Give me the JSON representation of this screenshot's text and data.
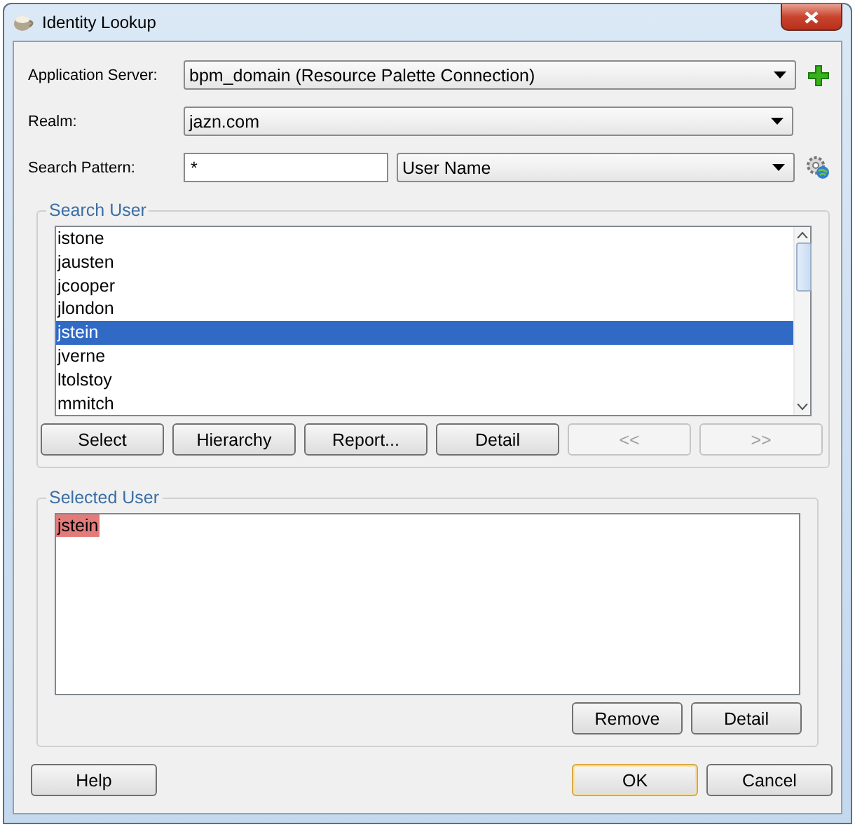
{
  "window": {
    "title": "Identity Lookup"
  },
  "application_server": {
    "label": "Application Server:",
    "value": "bpm_domain (Resource Palette Connection)"
  },
  "realm": {
    "label": "Realm:",
    "value": "jazn.com"
  },
  "search_pattern": {
    "label": "Search Pattern:",
    "value": "*",
    "attribute": "User Name"
  },
  "search_user": {
    "title": "Search User",
    "items": [
      {
        "name": "istone",
        "selected": false
      },
      {
        "name": "jausten",
        "selected": false
      },
      {
        "name": "jcooper",
        "selected": false
      },
      {
        "name": "jlondon",
        "selected": false
      },
      {
        "name": "jstein",
        "selected": true
      },
      {
        "name": "jverne",
        "selected": false
      },
      {
        "name": "ltolstoy",
        "selected": false
      },
      {
        "name": "mmitch",
        "selected": false
      }
    ],
    "buttons": [
      {
        "label": "Select",
        "disabled": false
      },
      {
        "label": "Hierarchy",
        "disabled": false
      },
      {
        "label": "Report...",
        "disabled": false
      },
      {
        "label": "Detail",
        "disabled": false
      },
      {
        "label": "<<",
        "disabled": true
      },
      {
        "label": ">>",
        "disabled": true
      }
    ]
  },
  "selected_user": {
    "title": "Selected User",
    "items": [
      {
        "name": "jstein",
        "highlighted": true
      }
    ],
    "buttons": [
      {
        "label": "Remove"
      },
      {
        "label": "Detail"
      }
    ]
  },
  "help_button": {
    "label": "Help"
  },
  "dialog_buttons": [
    {
      "label": "OK",
      "default": true
    },
    {
      "label": "Cancel",
      "default": false
    }
  ]
}
